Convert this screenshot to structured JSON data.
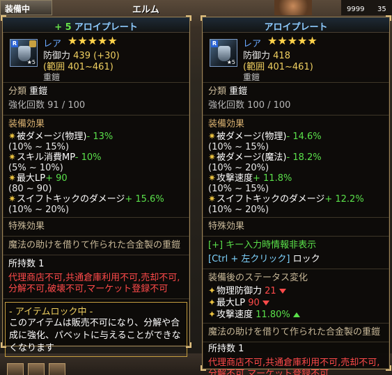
{
  "hud": {
    "equip_label": "装備中",
    "location": "エルム",
    "resource1": "9999",
    "resource2": "35"
  },
  "left": {
    "title_plus": "+ 5",
    "title": "アロイプレート",
    "rarity": "レア",
    "stars": "★★★★★",
    "defense_label": "防御力",
    "defense": "439 (+30)",
    "range": "(範囲 401~461)",
    "type_small": "重鎧",
    "category_label": "分類",
    "category": "重鎧",
    "enhance_label": "強化回数",
    "enhance": "91 / 100",
    "effects_header": "装備効果",
    "effects": [
      {
        "name": "被ダメージ(物理)",
        "value": "- 13%",
        "range": "(10% ~ 15%)"
      },
      {
        "name": "スキル消費MP",
        "value": "- 10%",
        "range": "(5% ~ 10%)"
      },
      {
        "name": "最大LP",
        "value": "+ 90",
        "range": "(80 ~ 90)"
      },
      {
        "name": "スイフトキックのダメージ",
        "value": "+ 15.6%",
        "range": "(10% ~ 20%)"
      }
    ],
    "special_header": "特殊効果",
    "description": "魔法の助けを借りて作られた合金製の重鎧",
    "owned_label": "所持数",
    "owned": "1",
    "restriction": "代理商店不可,共通倉庫利用不可,売却不可,分解不可,破壊不可,マーケット登録不可",
    "lock_title": "- アイテムロック中 -",
    "lock_text": "このアイテムは販売不可になり、分解や合成に強化、パベットに与えることができなくなります"
  },
  "right": {
    "title": "アロイプレート",
    "rarity": "レア",
    "stars": "★★★★★",
    "defense_label": "防御力",
    "defense": "418",
    "range": "(範囲 401~461)",
    "type_small": "重鎧",
    "category_label": "分類",
    "category": "重鎧",
    "enhance_label": "強化回数",
    "enhance": "100 / 100",
    "effects_header": "装備効果",
    "effects": [
      {
        "name": "被ダメージ(物理)",
        "value": "- 14.6%",
        "range": "(10% ~ 15%)"
      },
      {
        "name": "被ダメージ(魔法)",
        "value": "- 18.2%",
        "range": "(10% ~ 20%)"
      },
      {
        "name": "攻撃速度",
        "value": "+ 11.8%",
        "range": "(10% ~ 15%)"
      },
      {
        "name": "スイフトキックのダメージ",
        "value": "+ 12.2%",
        "range": "(10% ~ 20%)"
      }
    ],
    "special_header": "特殊効果",
    "hint1": "[+] キー入力時情報非表示",
    "hint2_key": "[Ctrl + 左クリック]",
    "hint2_text": "ロック",
    "change_header": "装備後のステータス変化",
    "changes": [
      {
        "name": "物理防御力",
        "value": "21",
        "dir": "down"
      },
      {
        "name": "最大LP",
        "value": "90",
        "dir": "down"
      },
      {
        "name": "攻撃速度",
        "value": "11.80%",
        "dir": "up"
      }
    ],
    "description": "魔法の助けを借りて作られた合金製の重鎧",
    "owned_label": "所持数",
    "owned": "1",
    "restriction": "代理商店不可,共通倉庫利用不可,売却不可,分解不可,マーケット登録不可"
  }
}
